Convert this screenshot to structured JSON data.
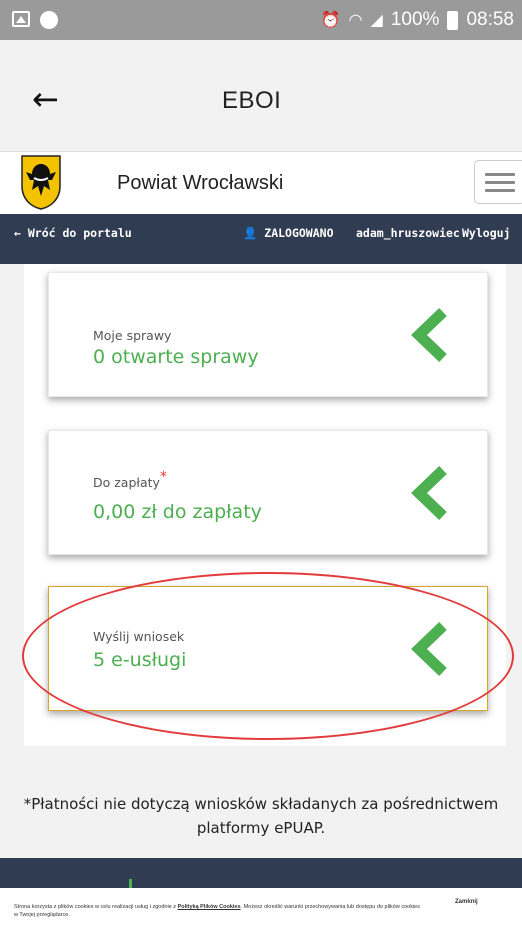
{
  "status_bar": {
    "battery": "100%",
    "time": "08:58"
  },
  "app_bar": {
    "back_icon": "arrow-left-icon",
    "title": "EBOI"
  },
  "site_header": {
    "portal_name": "Powiat Wrocławski",
    "menu_icon": "hamburger-icon"
  },
  "nav": {
    "back_to_portal": "← Wróć do portalu",
    "logged_in": "ZALOGOWANO",
    "username": "adam_hruszowiec",
    "logout": "Wyloguj"
  },
  "cards": [
    {
      "label": "Moje sprawy",
      "value": "0 otwarte sprawy",
      "required_mark": ""
    },
    {
      "label": "Do zapłaty",
      "value": "0,00 zł do zapłaty",
      "required_mark": "*"
    },
    {
      "label": "Wyślij wniosek",
      "value": "5 e-usługi",
      "required_mark": ""
    }
  ],
  "note": "*Płatności nie dotyczą wniosków składanych za pośrednictwem platformy ePUAP.",
  "cookie_bar": {
    "text_before": "Strona korzysta z plików cookies w celu realizacji usług i zgodnie z",
    "policy_link": "Polityką Plików Cookies",
    "text_after": ". Możesz określić warunki przechowywania lub dostępu do plików cookies w Twojej przeglądarce.",
    "close": "Zamknij"
  },
  "colors": {
    "accent_green": "#4caf50",
    "nav_bg": "#2f3c52",
    "highlight_border": "#d9a52a",
    "annotation_red": "#e23b3b"
  }
}
